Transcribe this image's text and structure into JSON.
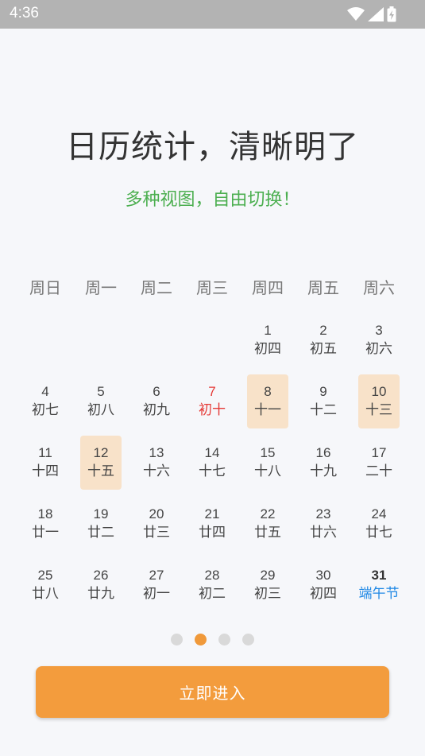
{
  "status_bar": {
    "time": "4:36",
    "icons": [
      "wifi-icon",
      "signal-icon",
      "battery-charging-icon"
    ]
  },
  "headline": "日历统计，清晰明了",
  "subline": "多种视图，自由切换！",
  "weekdays": [
    "周日",
    "周一",
    "周二",
    "周三",
    "周四",
    "周五",
    "周六"
  ],
  "calendar": {
    "weeks": [
      [
        null,
        null,
        null,
        null,
        {
          "day": "1",
          "lunar": "初四"
        },
        {
          "day": "2",
          "lunar": "初五"
        },
        {
          "day": "3",
          "lunar": "初六"
        }
      ],
      [
        {
          "day": "4",
          "lunar": "初七"
        },
        {
          "day": "5",
          "lunar": "初八"
        },
        {
          "day": "6",
          "lunar": "初九"
        },
        {
          "day": "7",
          "lunar": "初十",
          "style": "red"
        },
        {
          "day": "8",
          "lunar": "十一",
          "selected": true
        },
        {
          "day": "9",
          "lunar": "十二"
        },
        {
          "day": "10",
          "lunar": "十三",
          "selected": true
        }
      ],
      [
        {
          "day": "11",
          "lunar": "十四"
        },
        {
          "day": "12",
          "lunar": "十五",
          "selected": true
        },
        {
          "day": "13",
          "lunar": "十六"
        },
        {
          "day": "14",
          "lunar": "十七"
        },
        {
          "day": "15",
          "lunar": "十八"
        },
        {
          "day": "16",
          "lunar": "十九"
        },
        {
          "day": "17",
          "lunar": "二十"
        }
      ],
      [
        {
          "day": "18",
          "lunar": "廿一"
        },
        {
          "day": "19",
          "lunar": "廿二"
        },
        {
          "day": "20",
          "lunar": "廿三"
        },
        {
          "day": "21",
          "lunar": "廿四"
        },
        {
          "day": "22",
          "lunar": "廿五"
        },
        {
          "day": "23",
          "lunar": "廿六"
        },
        {
          "day": "24",
          "lunar": "廿七"
        }
      ],
      [
        {
          "day": "25",
          "lunar": "廿八"
        },
        {
          "day": "26",
          "lunar": "廿九"
        },
        {
          "day": "27",
          "lunar": "初一"
        },
        {
          "day": "28",
          "lunar": "初二"
        },
        {
          "day": "29",
          "lunar": "初三"
        },
        {
          "day": "30",
          "lunar": "初四"
        },
        {
          "day": "31",
          "lunar": "端午节",
          "style": "festival"
        }
      ]
    ]
  },
  "pager": {
    "count": 4,
    "active_index": 1
  },
  "enter_button_label": "立即进入",
  "colors": {
    "accent": "#f39c3d",
    "subline": "#4caf50",
    "selected_bg": "#f8e2c9",
    "holiday_red": "#e53935",
    "festival_blue": "#1e88e5"
  }
}
